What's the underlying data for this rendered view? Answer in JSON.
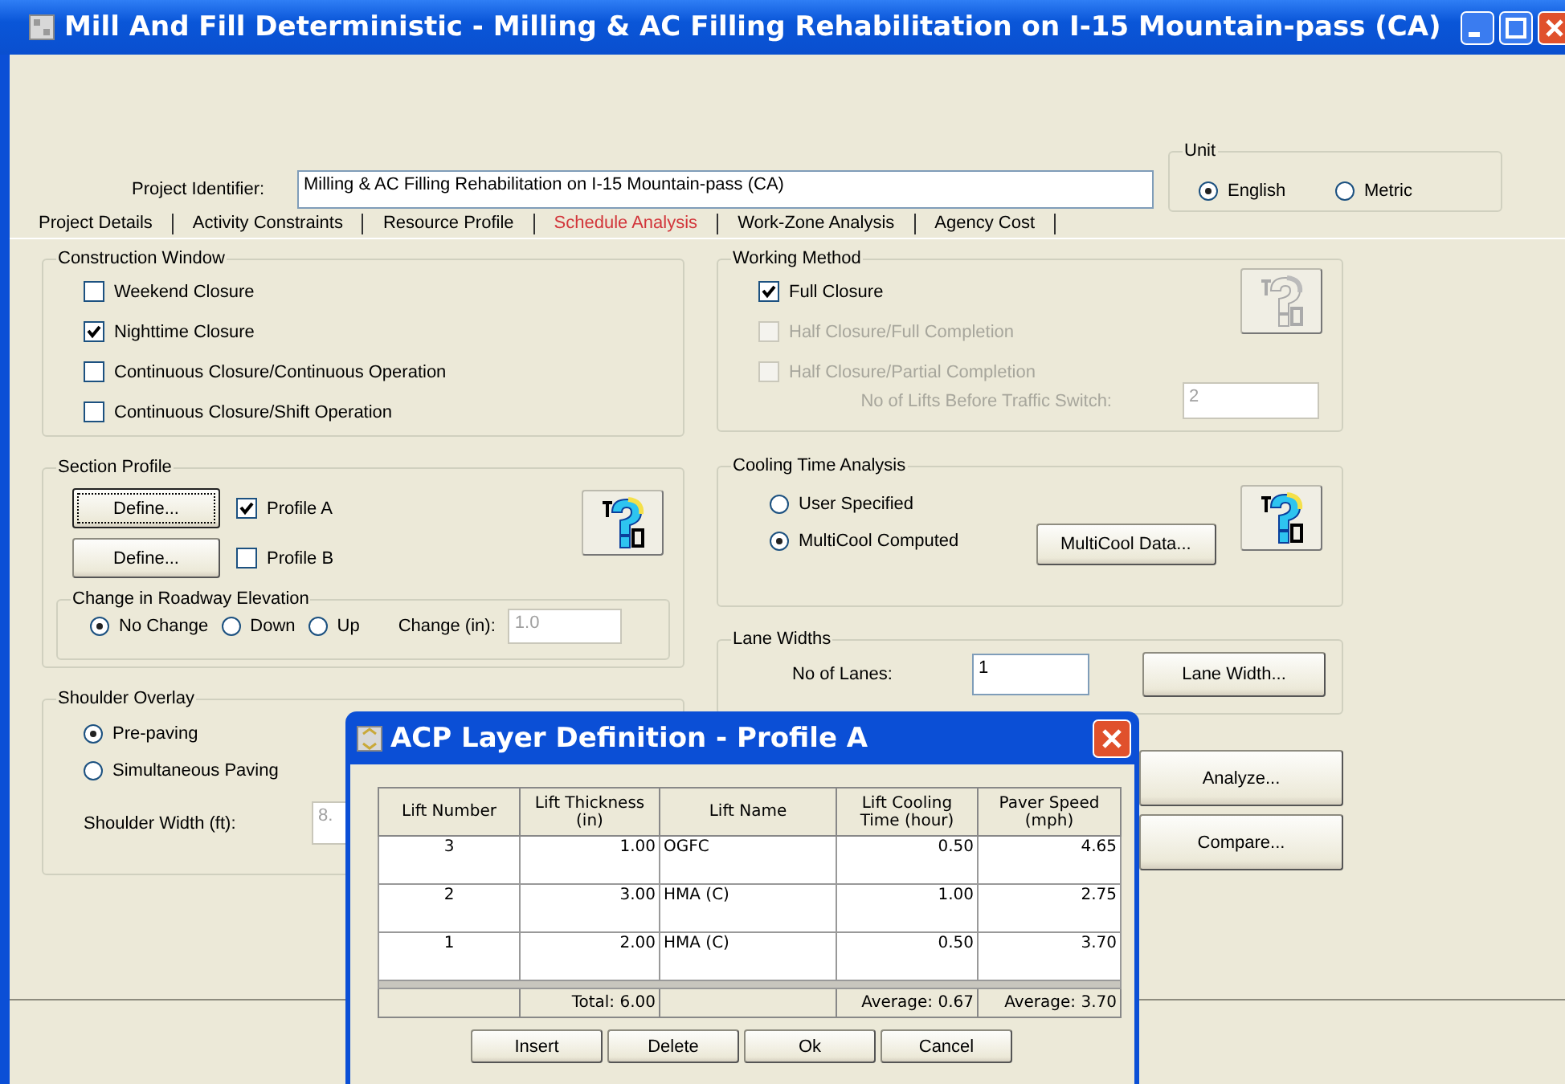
{
  "window": {
    "title": "Mill And Fill Deterministic - Milling & AC Filling Rehabilitation on I-15 Mountain-pass (CA)"
  },
  "project_identifier": {
    "label": "Project Identifier:",
    "value": "Milling & AC Filling Rehabilitation on I-15 Mountain-pass (CA)"
  },
  "unit": {
    "legend": "Unit",
    "options": [
      {
        "label": "English",
        "selected": true
      },
      {
        "label": "Metric",
        "selected": false
      }
    ]
  },
  "tabs": [
    {
      "label": "Project Details",
      "selected": false
    },
    {
      "label": "Activity Constraints",
      "selected": false
    },
    {
      "label": "Resource Profile",
      "selected": false
    },
    {
      "label": "Schedule Analysis",
      "selected": true
    },
    {
      "label": "Work-Zone Analysis",
      "selected": false
    },
    {
      "label": "Agency Cost",
      "selected": false
    }
  ],
  "construction_window": {
    "legend": "Construction Window",
    "options": [
      {
        "label": "Weekend Closure",
        "checked": false
      },
      {
        "label": "Nighttime Closure",
        "checked": true
      },
      {
        "label": "Continuous Closure/Continuous Operation",
        "checked": false
      },
      {
        "label": "Continuous Closure/Shift Operation",
        "checked": false
      }
    ]
  },
  "section_profile": {
    "legend": "Section Profile",
    "profiles": [
      {
        "button": "Define...",
        "focused": true,
        "label": "Profile A",
        "checked": true
      },
      {
        "button": "Define...",
        "focused": false,
        "label": "Profile B",
        "checked": false
      }
    ],
    "elevation": {
      "legend": "Change in Roadway Elevation",
      "options": [
        {
          "label": "No Change",
          "selected": true
        },
        {
          "label": "Down",
          "selected": false
        },
        {
          "label": "Up",
          "selected": false
        }
      ],
      "change_label": "Change (in):",
      "change_value": "1.0",
      "change_disabled": true
    }
  },
  "shoulder_overlay": {
    "legend": "Shoulder Overlay",
    "options": [
      {
        "label": "Pre-paving",
        "selected": true
      },
      {
        "label": "Simultaneous Paving",
        "selected": false
      }
    ],
    "width_label": "Shoulder Width (ft):",
    "width_value": "8.",
    "width_disabled": true
  },
  "working_method": {
    "legend": "Working Method",
    "info_disabled": true,
    "options": [
      {
        "label": "Full Closure",
        "checked": true,
        "disabled": false
      },
      {
        "label": "Half Closure/Full Completion",
        "checked": false,
        "disabled": true
      },
      {
        "label": "Half Closure/Partial Completion",
        "checked": false,
        "disabled": true
      }
    ],
    "lifts_label": "No of Lifts Before Traffic Switch:",
    "lifts_value": "2",
    "lifts_disabled": true
  },
  "cooling_time": {
    "legend": "Cooling Time Analysis",
    "info_disabled": false,
    "options": [
      {
        "label": "User Specified",
        "selected": false
      },
      {
        "label": "MultiCool Computed",
        "selected": true
      }
    ],
    "button": "MultiCool Data..."
  },
  "lane_widths": {
    "legend": "Lane Widths",
    "label": "No of Lanes:",
    "value": "1",
    "button": "Lane Width..."
  },
  "actions": [
    "Analyze...",
    "Compare..."
  ],
  "dialog": {
    "title": "ACP Layer Definition - Profile A",
    "columns": [
      "Lift Number",
      "Lift Thickness (in)",
      "Lift Name",
      "Lift Cooling Time (hour)",
      "Paver Speed (mph)"
    ],
    "rows": [
      [
        "3",
        "1.00",
        "OGFC",
        "0.50",
        "4.65"
      ],
      [
        "2",
        "3.00",
        "HMA (C)",
        "1.00",
        "2.75"
      ],
      [
        "1",
        "2.00",
        "HMA (C)",
        "0.50",
        "3.70"
      ]
    ],
    "footer": {
      "total_thickness": "Total: 6.00",
      "average_cooling": "Average: 0.67",
      "average_speed": "Average: 3.70"
    },
    "buttons": [
      "Insert",
      "Delete",
      "Ok",
      "Cancel"
    ]
  }
}
